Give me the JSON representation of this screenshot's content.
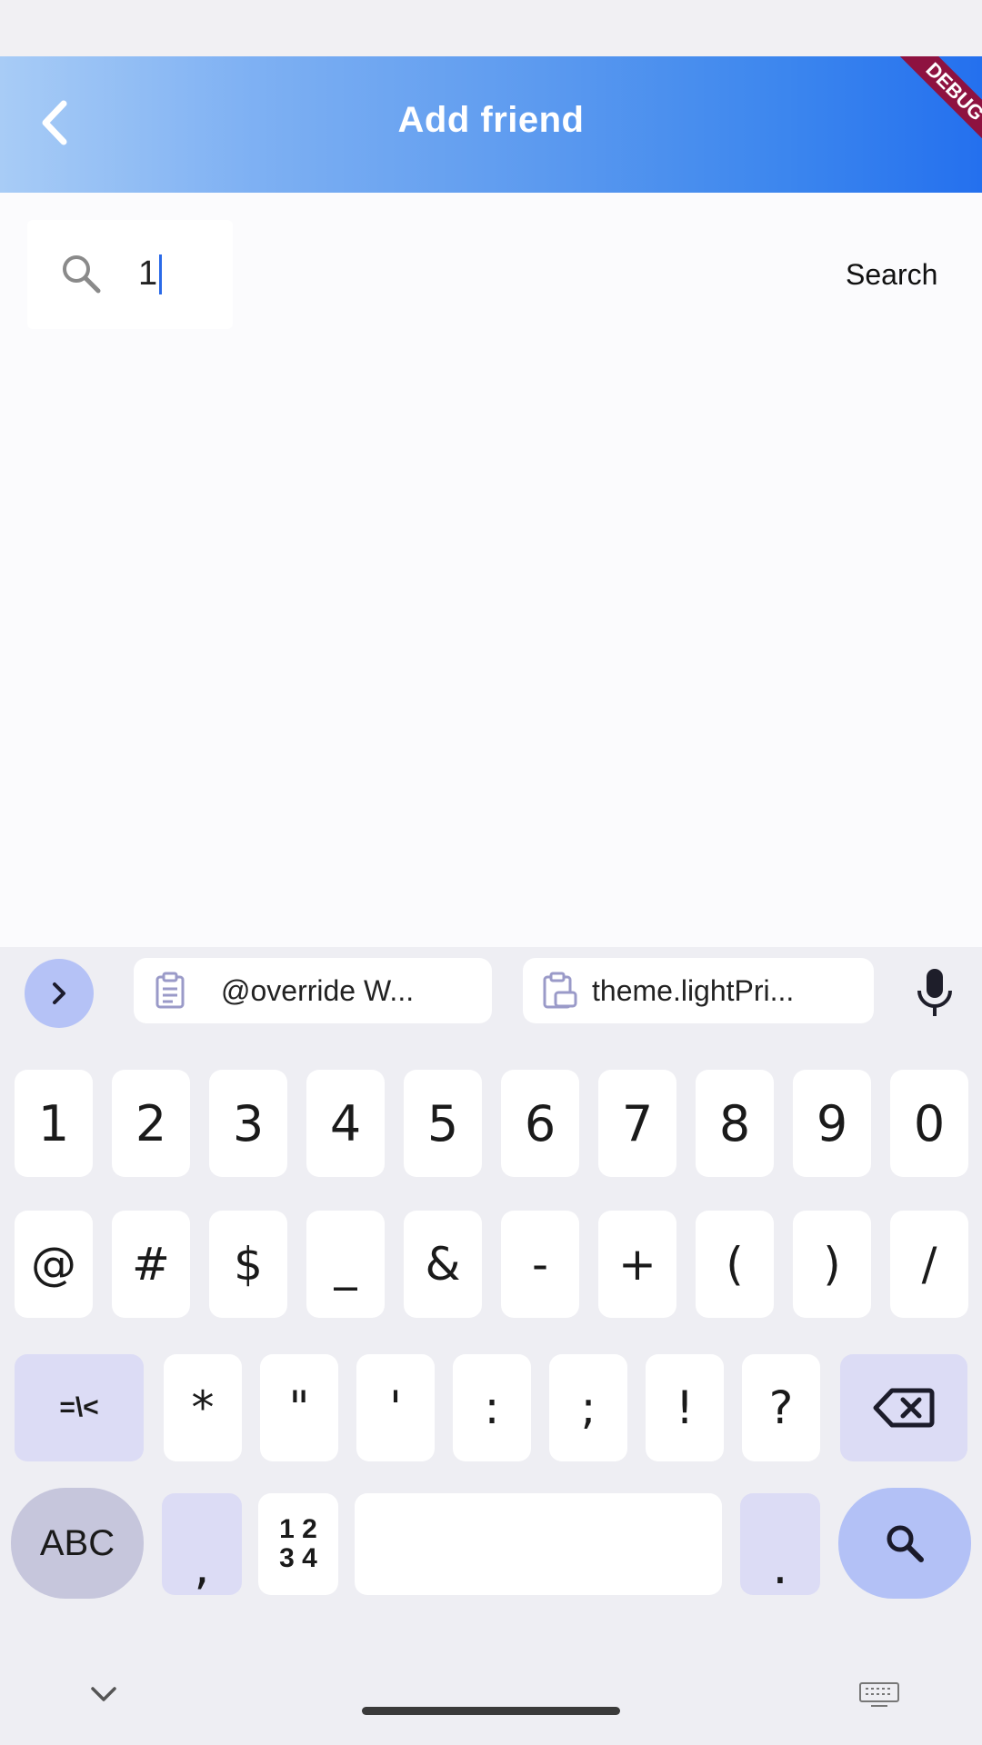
{
  "app_bar": {
    "title": "Add friend",
    "debug_banner": "DEBUG",
    "gradient_start": "#a8ccf6",
    "gradient_end": "#2470ee"
  },
  "search": {
    "value": "1",
    "action_label": "Search",
    "icon": "search-icon"
  },
  "keyboard": {
    "suggestions": [
      {
        "icon": "clipboard-icon",
        "text": "@override   W..."
      },
      {
        "icon": "clipboard-image-icon",
        "text": "theme.lightPri..."
      }
    ],
    "row1": [
      "1",
      "2",
      "3",
      "4",
      "5",
      "6",
      "7",
      "8",
      "9",
      "0"
    ],
    "row2": [
      "@",
      "#",
      "$",
      "_",
      "&",
      "-",
      "+",
      "(",
      ")",
      "/"
    ],
    "row3": [
      "=\\<",
      "*",
      "\"",
      "'",
      ":",
      ";",
      "!",
      "?"
    ],
    "row4": {
      "abc": "ABC",
      "comma": ",",
      "numpad": "1 2\n3 4",
      "period": "."
    }
  }
}
